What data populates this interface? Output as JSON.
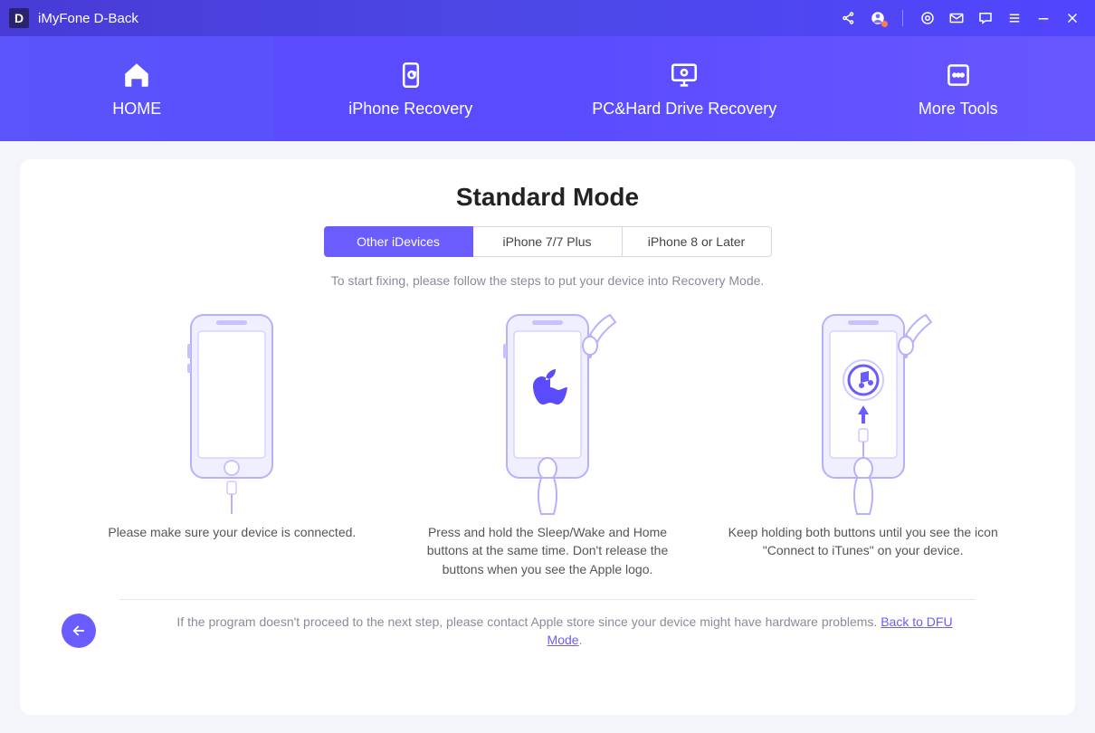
{
  "app": {
    "title": "iMyFone D-Back",
    "logo_letter": "D"
  },
  "nav": {
    "items": [
      {
        "label": "HOME"
      },
      {
        "label": "iPhone Recovery"
      },
      {
        "label": "PC&Hard Drive Recovery"
      },
      {
        "label": "More Tools"
      }
    ]
  },
  "main": {
    "heading": "Standard Mode",
    "tabs": [
      {
        "label": "Other iDevices",
        "active": true
      },
      {
        "label": "iPhone 7/7 Plus",
        "active": false
      },
      {
        "label": "iPhone 8 or Later",
        "active": false
      }
    ],
    "instruction": "To start fixing, please follow the steps to put your device into Recovery Mode.",
    "steps": [
      {
        "caption": "Please make sure your device is connected."
      },
      {
        "caption": "Press and hold the Sleep/Wake and Home buttons at the same time. Don't release the buttons when you see the Apple logo."
      },
      {
        "caption": "Keep holding both buttons until you see the icon \"Connect to iTunes\" on your device."
      }
    ],
    "footer": {
      "prefix": "If the program doesn't proceed to the next step, please contact Apple store since your device might have hardware problems. ",
      "link": "Back to DFU Mode",
      "suffix": "."
    }
  }
}
